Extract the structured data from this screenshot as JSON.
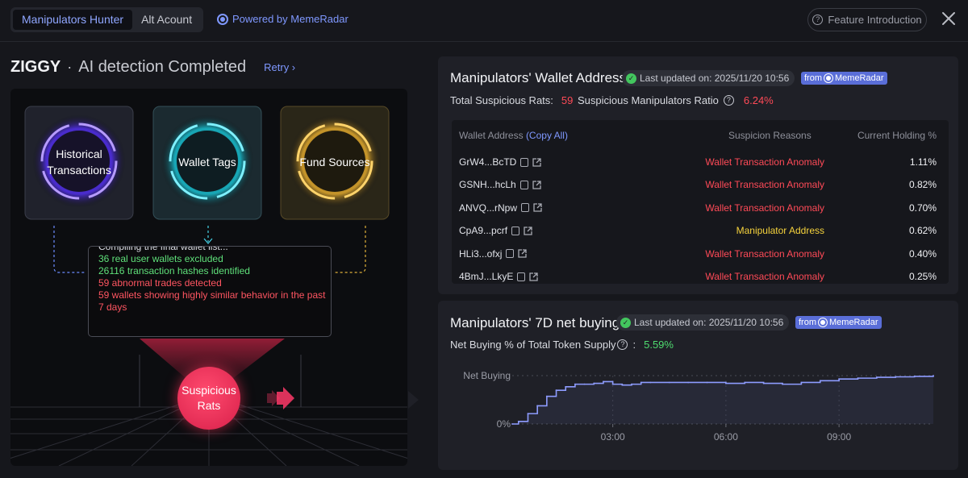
{
  "tabs": [
    {
      "label": "Manipulators Hunter",
      "active": true
    },
    {
      "label": "Alt Acount",
      "active": false
    }
  ],
  "powered_by": "Powered by MemeRadar",
  "feature_intro": "Feature Introduction",
  "token": {
    "name": "ZIGGY",
    "separator": "·",
    "status": "AI detection Completed",
    "retry": "Retry ›"
  },
  "sources": [
    {
      "label": "Historical Transactions",
      "color": "#8a5cff"
    },
    {
      "label": "Wallet Tags",
      "color": "#28c6d8"
    },
    {
      "label": "Fund Sources",
      "color": "#e0b13a"
    }
  ],
  "log": {
    "partial": "Compiling the final wallet list...",
    "lines": [
      {
        "text": "36 real user wallets excluded",
        "tone": "green"
      },
      {
        "text": "26116 transaction hashes identified",
        "tone": "green"
      },
      {
        "text": "59 abnormal trades detected",
        "tone": "red"
      },
      {
        "text": "59 wallets showing highly similar behavior in the past",
        "tone": "red"
      },
      {
        "text": "7 days",
        "tone": "red"
      }
    ]
  },
  "rats_label": "Suspicious Rats",
  "wallet_card": {
    "title": "Manipulators' Wallet Address",
    "updated": "Last updated on: 2025/11/20 10:56",
    "from": "from",
    "from_brand": "MemeRadar",
    "total_label": "Total Suspicious Rats:",
    "total_value": "59",
    "ratio_label": "Suspicious Manipulators Ratio",
    "ratio_value": "6.24%",
    "headers": {
      "address": "Wallet Address",
      "copy_all": "(Copy All)",
      "reasons": "Suspicion Reasons",
      "holding": "Current Holding %"
    },
    "rows": [
      {
        "address": "GrW4...BcTD",
        "reason": "Wallet Transaction Anomaly",
        "kind": "anom",
        "holding": "1.11%"
      },
      {
        "address": "GSNH...hcLh",
        "reason": "Wallet Transaction Anomaly",
        "kind": "anom",
        "holding": "0.82%"
      },
      {
        "address": "ANVQ...rNpw",
        "reason": "Wallet Transaction Anomaly",
        "kind": "anom",
        "holding": "0.70%"
      },
      {
        "address": "CpA9...pcrf",
        "reason": "Manipulator Address",
        "kind": "manip",
        "holding": "0.62%"
      },
      {
        "address": "HLi3...ofxj",
        "reason": "Wallet Transaction Anomaly",
        "kind": "anom",
        "holding": "0.40%"
      },
      {
        "address": "4BmJ...LkyE",
        "reason": "Wallet Transaction Anomaly",
        "kind": "anom",
        "holding": "0.25%"
      }
    ]
  },
  "buying_card": {
    "title": "Manipulators' 7D net buying",
    "updated": "Last updated on: 2025/11/20 10:56",
    "from": "from",
    "from_brand": "MemeRadar",
    "net_label": "Net Buying % of Total Token Supply",
    "net_colon": ":",
    "net_value": "5.59%"
  },
  "chart_data": {
    "type": "line",
    "title": "",
    "xlabel": "",
    "ylabel": "",
    "y_tick_labels": [
      "Net Buying",
      "0%"
    ],
    "x_tick_labels": [
      "03:00",
      "06:00",
      "09:00"
    ],
    "x": [
      "00:20",
      "00:30",
      "00:45",
      "01:00",
      "01:15",
      "01:30",
      "01:45",
      "02:00",
      "02:15",
      "02:30",
      "02:45",
      "03:00",
      "03:15",
      "03:30",
      "03:45",
      "04:00",
      "04:30",
      "05:00",
      "05:30",
      "06:00",
      "06:30",
      "07:00",
      "07:30",
      "08:00",
      "08:30",
      "09:00",
      "09:30",
      "10:00",
      "10:30",
      "11:00",
      "11:30"
    ],
    "series": [
      {
        "color": "#8e9cff",
        "values": [
          0.0,
          0.3,
          1.2,
          2.1,
          3.2,
          3.9,
          4.3,
          4.6,
          4.6,
          4.7,
          4.9,
          4.6,
          4.5,
          4.6,
          4.8,
          4.8,
          4.8,
          4.8,
          4.8,
          4.7,
          4.8,
          4.7,
          4.6,
          4.8,
          5.0,
          5.2,
          5.3,
          5.4,
          5.45,
          5.5,
          5.59
        ]
      }
    ],
    "grid": true,
    "line_color": "#8e9cff"
  }
}
